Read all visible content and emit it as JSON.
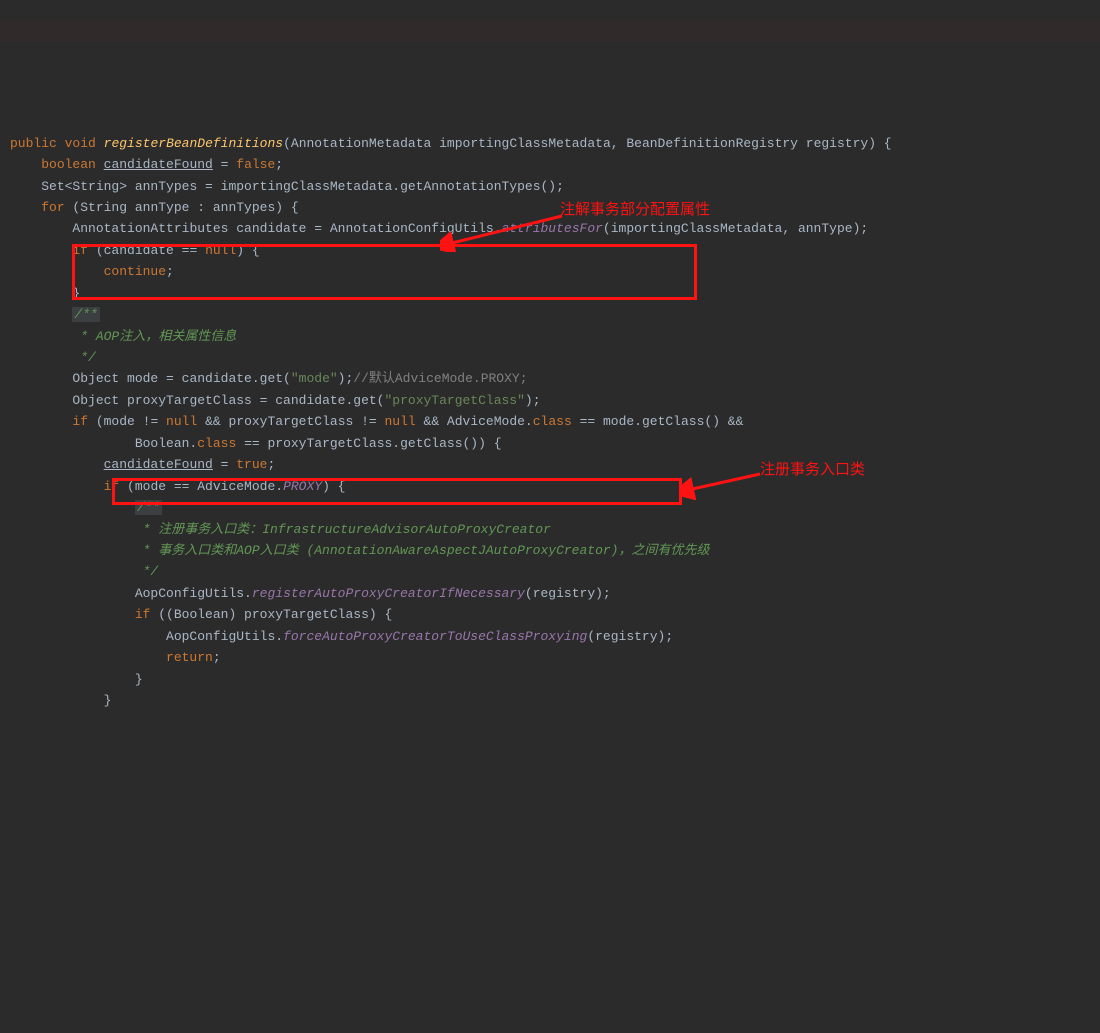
{
  "annotations": {
    "a1": "注解事务部分配置属性",
    "a2": "注册事务入口类"
  },
  "code": {
    "l1a": "public",
    "l1b": "void",
    "l1c": "registerBeanDefinitions",
    "l1d": "(AnnotationMetadata importingClassMetadata, BeanDefinitionRegistry registry) {",
    "l2a": "boolean",
    "l2b": "candidateFound",
    "l2c": " = ",
    "l2d": "false",
    "l2e": ";",
    "l3a": "Set<String> annTypes = importingClassMetadata.getAnnotationTypes();",
    "l4a": "for",
    "l4b": " (String annType : annTypes) {",
    "l5a": "AnnotationAttributes candidate = AnnotationConfigUtils.",
    "l5b": "attributesFor",
    "l5c": "(importingClassMetadata, annType);",
    "l6a": "if",
    "l6b": " (candidate == ",
    "l6c": "null",
    "l6d": ") {",
    "l7a": "continue",
    "l7b": ";",
    "l8a": "}",
    "l9a": "/**",
    "l10a": " * AOP注入，相关属性信息",
    "l11a": " *",
    "l12a": "/",
    "l13a": "Object mode = candidate.get(",
    "l13b": "\"mode\"",
    "l13c": ");",
    "l13d": "//默认AdviceMode.PROXY;",
    "l14a": "Object proxyTargetClass = candidate.get(",
    "l14b": "\"proxyTargetClass\"",
    "l14c": ");",
    "l15a": "if",
    "l15b": " (mode != ",
    "l15c": "null",
    "l15d": " && proxyTargetClass != ",
    "l15e": "null",
    "l15f": " && AdviceMode.",
    "l15g": "class",
    "l15h": " == mode.getClass() &&",
    "l16a": "Boolean.",
    "l16b": "class",
    "l16c": " == proxyTargetClass.getClass()) {",
    "l17a": "candidateFound",
    "l17b": " = ",
    "l17c": "true",
    "l17d": ";",
    "l18a": "if",
    "l18b": " (mode == AdviceMode.",
    "l18c": "PROXY",
    "l18d": ") {",
    "l19a": "/**",
    "l20a": " * 注册事务入口类：",
    "l20b": "InfrastructureAdvisorAutoProxyCreator",
    "l21a": " * 事务入口类和AOP入口类 ",
    "l21b": "(AnnotationAwareAspectJAutoProxyCreator)",
    "l21c": "，之间有优先级",
    "l22a": " */",
    "l23a": "AopConfigUtils.",
    "l23b": "registerAutoProxyCreatorIfNecessary",
    "l23c": "(registry);",
    "l24a": "if",
    "l24b": " ((Boolean) proxyTargetClass) {",
    "l25a": "AopConfigUtils.",
    "l25b": "forceAutoProxyCreatorToUseClassProxying",
    "l25c": "(registry);",
    "l26a": "return",
    "l26b": ";",
    "l27a": "}",
    "l28a": "}"
  }
}
